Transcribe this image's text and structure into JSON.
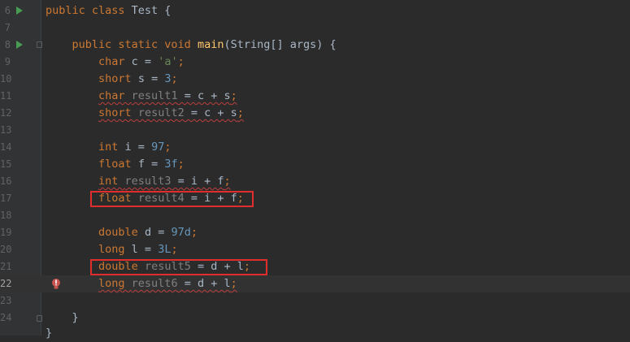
{
  "editor": {
    "lines": [
      {
        "num": "6",
        "run": true,
        "parts": [
          [
            "kw",
            "public class "
          ],
          [
            "p",
            "Test {"
          ]
        ]
      },
      {
        "num": "7",
        "parts": []
      },
      {
        "num": "8",
        "run": true,
        "fold": true,
        "parts": [
          [
            "p",
            "    "
          ],
          [
            "kw",
            "public static void "
          ],
          [
            "fn",
            "main"
          ],
          [
            "p",
            "(String[] args) {"
          ]
        ]
      },
      {
        "num": "9",
        "parts": [
          [
            "p",
            "        "
          ],
          [
            "kw",
            "char "
          ],
          [
            "p",
            "c = "
          ],
          [
            "str",
            "'a'"
          ],
          [
            "kw",
            ";"
          ]
        ]
      },
      {
        "num": "10",
        "parts": [
          [
            "p",
            "        "
          ],
          [
            "kw",
            "short "
          ],
          [
            "p",
            "s = "
          ],
          [
            "num",
            "3"
          ],
          [
            "kw",
            ";"
          ]
        ]
      },
      {
        "num": "11",
        "parts": [
          [
            "p",
            "        "
          ],
          [
            "kwsq",
            "char "
          ],
          [
            "unsq",
            "result1"
          ],
          [
            "sq",
            " = c + s"
          ],
          [
            "kwsq",
            ";"
          ]
        ]
      },
      {
        "num": "12",
        "parts": [
          [
            "p",
            "        "
          ],
          [
            "kwsq",
            "short "
          ],
          [
            "unsq",
            "result2"
          ],
          [
            "sq",
            " = c + s"
          ],
          [
            "kwsq",
            ";"
          ]
        ]
      },
      {
        "num": "13",
        "parts": []
      },
      {
        "num": "14",
        "parts": [
          [
            "p",
            "        "
          ],
          [
            "kw",
            "int "
          ],
          [
            "p",
            "i = "
          ],
          [
            "num",
            "97"
          ],
          [
            "kw",
            ";"
          ]
        ]
      },
      {
        "num": "15",
        "parts": [
          [
            "p",
            "        "
          ],
          [
            "kw",
            "float "
          ],
          [
            "p",
            "f = "
          ],
          [
            "num",
            "3f"
          ],
          [
            "kw",
            ";"
          ]
        ]
      },
      {
        "num": "16",
        "parts": [
          [
            "p",
            "        "
          ],
          [
            "kwsq",
            "int "
          ],
          [
            "unsq",
            "result3"
          ],
          [
            "sq",
            " = i + f"
          ],
          [
            "kwsq",
            ";"
          ]
        ]
      },
      {
        "num": "17",
        "parts": [
          [
            "p",
            "        "
          ],
          [
            "kw",
            "float "
          ],
          [
            "unused",
            "result4"
          ],
          [
            "p",
            " = i + f"
          ],
          [
            "kw",
            ";"
          ]
        ]
      },
      {
        "num": "18",
        "parts": []
      },
      {
        "num": "19",
        "parts": [
          [
            "p",
            "        "
          ],
          [
            "kw",
            "double "
          ],
          [
            "p",
            "d = "
          ],
          [
            "num",
            "97d"
          ],
          [
            "kw",
            ";"
          ]
        ]
      },
      {
        "num": "20",
        "parts": [
          [
            "p",
            "        "
          ],
          [
            "kw",
            "long "
          ],
          [
            "p",
            "l = "
          ],
          [
            "num",
            "3L"
          ],
          [
            "kw",
            ";"
          ]
        ]
      },
      {
        "num": "21",
        "parts": [
          [
            "p",
            "        "
          ],
          [
            "kw",
            "double "
          ],
          [
            "unused",
            "result5"
          ],
          [
            "p",
            " = d + l"
          ],
          [
            "kw",
            ";"
          ]
        ]
      },
      {
        "num": "22",
        "current": true,
        "bulb": true,
        "parts": [
          [
            "p",
            "        "
          ],
          [
            "kwsq",
            "long "
          ],
          [
            "unsq",
            "result6"
          ],
          [
            "sq",
            " = d + l"
          ],
          [
            "kwsq",
            ";"
          ]
        ]
      },
      {
        "num": "23",
        "parts": []
      },
      {
        "num": "24",
        "foldEnd": true,
        "parts": [
          [
            "p",
            "    }"
          ]
        ]
      }
    ],
    "trailing": "}"
  },
  "colors": {
    "background": "#2b2b2b",
    "gutter": "#313335",
    "keyword": "#cc7832",
    "method": "#ffc66d",
    "string": "#6a8759",
    "number": "#6897bb",
    "unused": "#808080",
    "error_underline": "#bc3f3c",
    "highlight_box": "#e02e2e"
  },
  "icons": {
    "run": "run-gutter-icon",
    "fold": "fold-marker-icon",
    "error_bulb": "error-bulb-icon"
  }
}
